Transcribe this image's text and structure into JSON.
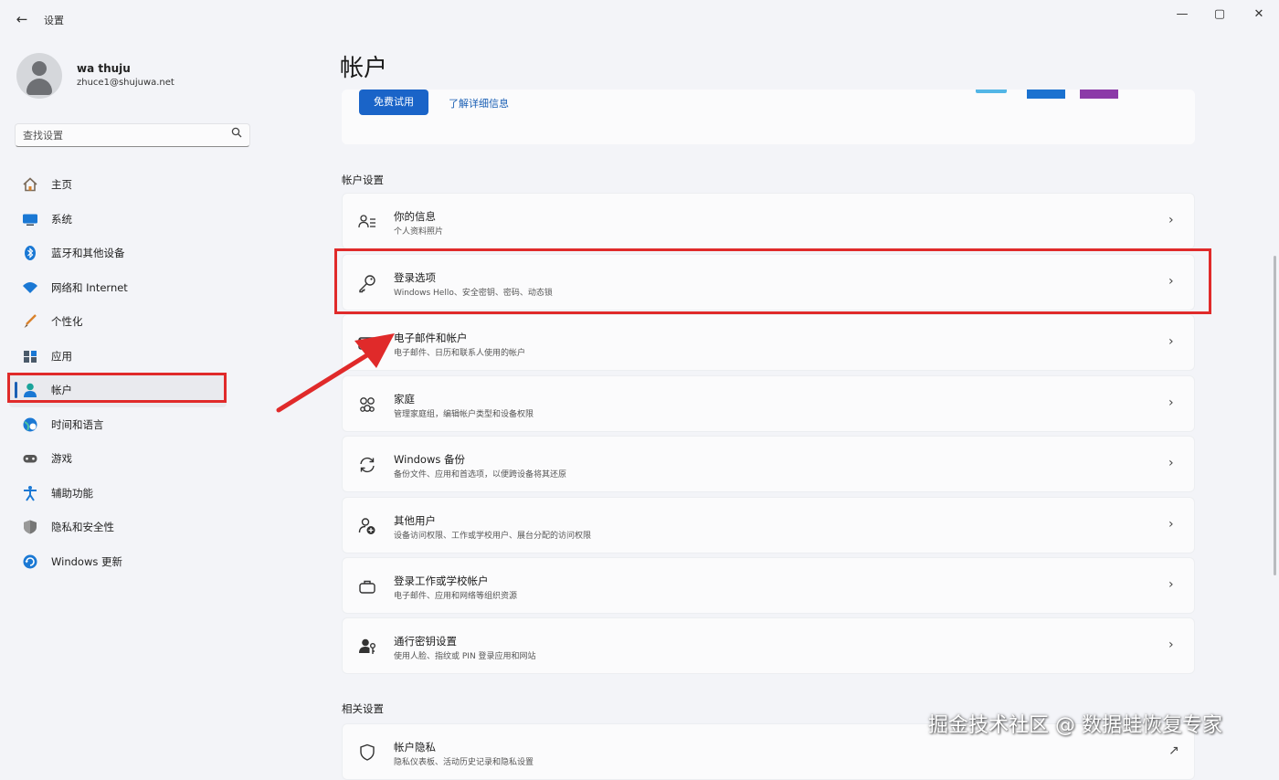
{
  "window": {
    "title": "设置",
    "back_icon": "←",
    "minimize_icon": "—",
    "maximize_icon": "▢",
    "close_icon": "✕"
  },
  "profile": {
    "name": "wa thuju",
    "email": "zhuce1@shujuwa.net"
  },
  "search": {
    "placeholder": "查找设置",
    "icon": "search-icon"
  },
  "sidebar": {
    "items": [
      {
        "label": "主页",
        "icon": "home-icon",
        "color": "#7a6a5a"
      },
      {
        "label": "系统",
        "icon": "display-icon",
        "color": "#1a78d4"
      },
      {
        "label": "蓝牙和其他设备",
        "icon": "bluetooth-icon",
        "color": "#1a78d4"
      },
      {
        "label": "网络和 Internet",
        "icon": "wifi-icon",
        "color": "#1a78d4"
      },
      {
        "label": "个性化",
        "icon": "brush-icon",
        "color": "#d9822b"
      },
      {
        "label": "应用",
        "icon": "apps-icon",
        "color": "#4a5a6a"
      },
      {
        "label": "帐户",
        "icon": "account-icon",
        "color": "#1aa39a"
      },
      {
        "label": "时间和语言",
        "icon": "globe-clock-icon",
        "color": "#1a78d4"
      },
      {
        "label": "游戏",
        "icon": "gamepad-icon",
        "color": "#555555"
      },
      {
        "label": "辅助功能",
        "icon": "accessibility-icon",
        "color": "#1a78d4"
      },
      {
        "label": "隐私和安全性",
        "icon": "shield-icon",
        "color": "#666666"
      },
      {
        "label": "Windows 更新",
        "icon": "update-icon",
        "color": "#1a78d4"
      }
    ],
    "active_index": 6
  },
  "main": {
    "title": "帐户",
    "promo": {
      "button_label": "免费试用",
      "link_label": "了解详细信息"
    },
    "account_settings_label": "帐户设置",
    "cards": [
      {
        "title": "你的信息",
        "subtitle": "个人资料照片",
        "icon": "person-info-icon"
      },
      {
        "title": "登录选项",
        "subtitle": "Windows Hello、安全密钥、密码、动态锁",
        "icon": "key-icon"
      },
      {
        "title": "电子邮件和帐户",
        "subtitle": "电子邮件、日历和联系人使用的帐户",
        "icon": "mail-icon"
      },
      {
        "title": "家庭",
        "subtitle": "管理家庭组，编辑帐户类型和设备权限",
        "icon": "family-icon"
      },
      {
        "title": "Windows 备份",
        "subtitle": "备份文件、应用和首选项，以便跨设备将其还原",
        "icon": "sync-icon"
      },
      {
        "title": "其他用户",
        "subtitle": "设备访问权限、工作或学校用户、展台分配的访问权限",
        "icon": "person-add-icon"
      },
      {
        "title": "登录工作或学校帐户",
        "subtitle": "电子邮件、应用和网络等组织资源",
        "icon": "briefcase-icon"
      },
      {
        "title": "通行密钥设置",
        "subtitle": "使用人脸、指纹或 PIN 登录应用和网站",
        "icon": "passkey-icon"
      }
    ],
    "related_settings_label": "相关设置",
    "related_cards": [
      {
        "title": "帐户隐私",
        "subtitle": "隐私仪表板、活动历史记录和隐私设置",
        "icon": "shield-icon",
        "trailing_icon": "open-external-icon"
      }
    ]
  },
  "chevron": "›",
  "external": "↗",
  "watermark": "掘金技术社区 @ 数据蛙恢复专家",
  "highlight_color": "#e02a2a"
}
